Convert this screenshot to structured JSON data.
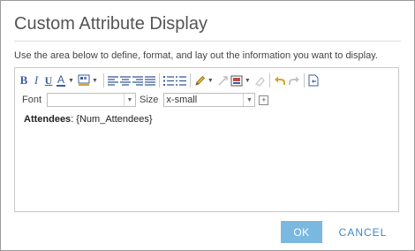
{
  "dialog": {
    "title": "Custom Attribute Display",
    "instructions": "Use the area below to define, format, and lay out the information you want to display."
  },
  "toolbar": {
    "bold": "B",
    "italic": "I",
    "underline": "U",
    "font_color": "A",
    "font_label": "Font",
    "font_value": "",
    "size_label": "Size",
    "size_value": "x-small",
    "icons": [
      "bold-icon",
      "italic-icon",
      "underline-icon",
      "font-color-icon",
      "highlight-color-icon",
      "align-left-icon",
      "align-center-icon",
      "align-right-icon",
      "justify-icon",
      "ordered-list-icon",
      "unordered-list-icon",
      "pencil-icon",
      "unlink-icon",
      "insert-image-icon",
      "eraser-icon",
      "undo-icon",
      "redo-icon",
      "view-source-icon",
      "plus-icon"
    ],
    "accent_color": "#3b5e9b"
  },
  "content": {
    "field_label": "Attendees",
    "field_sep": ":",
    "field_value": " {Num_Attendees}"
  },
  "buttons": {
    "ok": "OK",
    "cancel": "CANCEL",
    "ok_color": "#7ab8e0",
    "cancel_color": "#3f87c5"
  }
}
